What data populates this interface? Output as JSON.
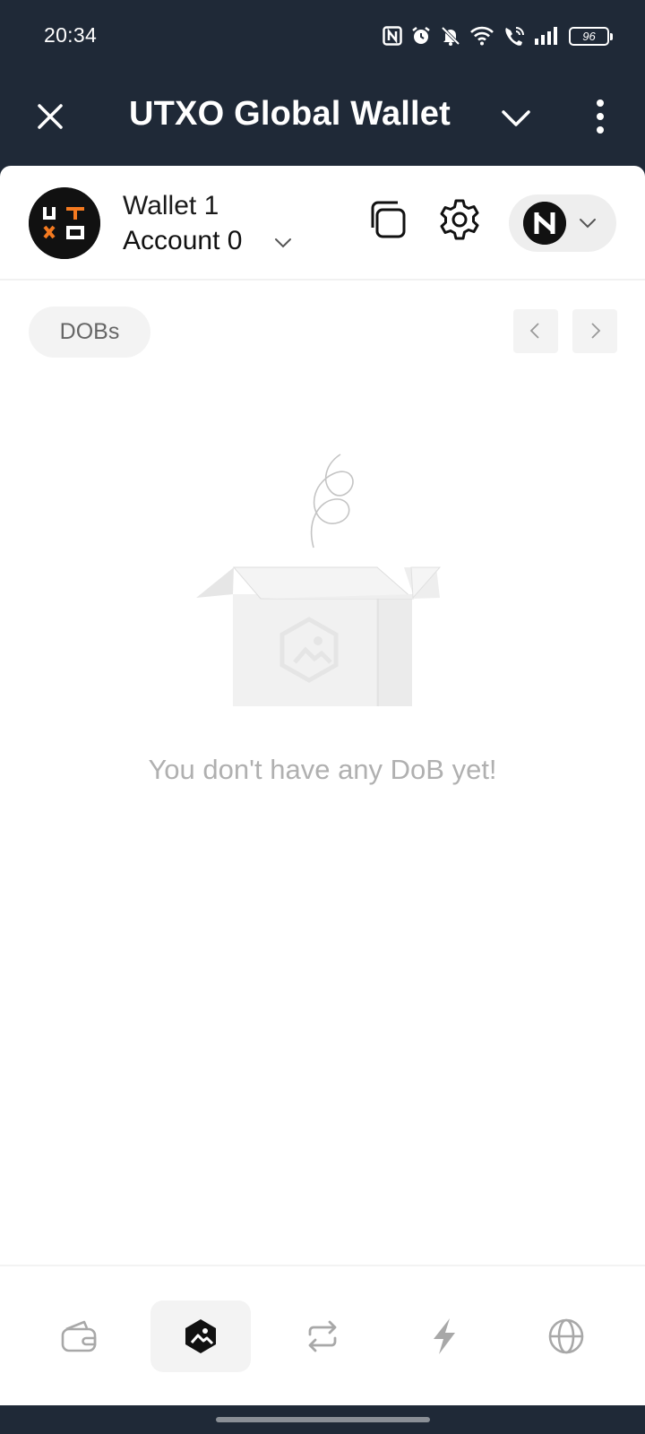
{
  "status_bar": {
    "time": "20:34",
    "battery": "96",
    "icons": [
      "nfc-icon",
      "alarm-icon",
      "bell-off-icon",
      "wifi-icon",
      "wifi-call-icon",
      "signal-icon",
      "battery-icon"
    ]
  },
  "title_bar": {
    "title": "UTXO Global Wallet",
    "icons": [
      "close-icon",
      "chevron-down-icon",
      "more-vertical-icon"
    ]
  },
  "header": {
    "wallet_name": "Wallet 1",
    "account_name": "Account 0",
    "icons": [
      "utxo-logo",
      "chevron-down-icon",
      "copy-icon",
      "gear-icon",
      "network-logo",
      "chevron-down-icon"
    ]
  },
  "filter": {
    "chip_label": "DOBs"
  },
  "empty_state": {
    "message": "You don't have any DoB yet!"
  },
  "bottom_nav": {
    "active_tab": "dob",
    "tabs": [
      {
        "id": "wallet",
        "icon": "wallet-icon"
      },
      {
        "id": "dob",
        "icon": "dob-image-icon"
      },
      {
        "id": "swap",
        "icon": "swap-icon"
      },
      {
        "id": "lightning",
        "icon": "bolt-icon"
      },
      {
        "id": "browser",
        "icon": "globe-icon"
      }
    ]
  },
  "colors": {
    "title_bar_bg": "#1f2937",
    "accent_orange": "#f47a20",
    "text_primary": "#111111",
    "text_muted": "#b0b0b0",
    "chip_bg": "#f3f3f3"
  }
}
